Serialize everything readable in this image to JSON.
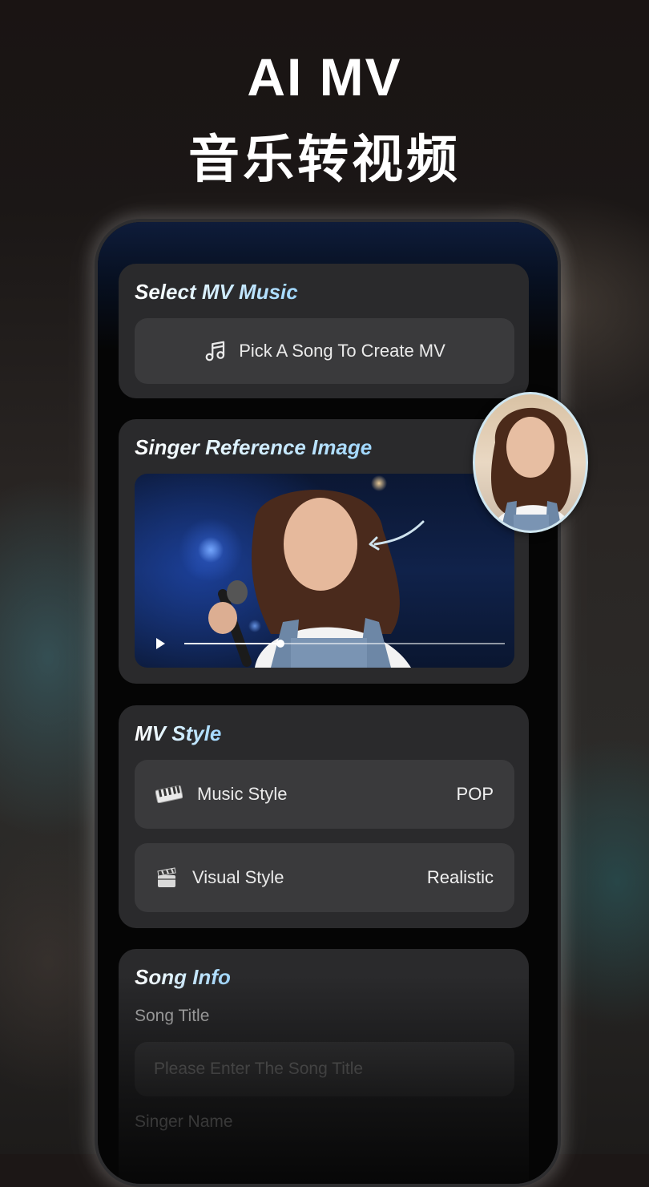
{
  "headline": {
    "line1": "AI MV",
    "line2": "音乐转视频"
  },
  "music_card": {
    "title": "Select MV Music",
    "pick_label": "Pick A Song To Create MV",
    "icon": "music-note-icon"
  },
  "reference_card": {
    "title": "Singer Reference Image",
    "video_progress": 0.3
  },
  "style_card": {
    "title": "MV Style",
    "music_style": {
      "label": "Music Style",
      "value": "POP",
      "icon": "piano-keyboard-icon"
    },
    "visual_style": {
      "label": "Visual Style",
      "value": "Realistic",
      "icon": "clapperboard-icon"
    }
  },
  "song_info": {
    "title": "Song Info",
    "song_title_label": "Song Title",
    "song_title_placeholder": "Please Enter The Song Title",
    "singer_name_label": "Singer Name"
  },
  "colors": {
    "card": "#2a2a2c",
    "pill": "#3a3a3c",
    "title_gradient_end": "#9fd7ff"
  }
}
